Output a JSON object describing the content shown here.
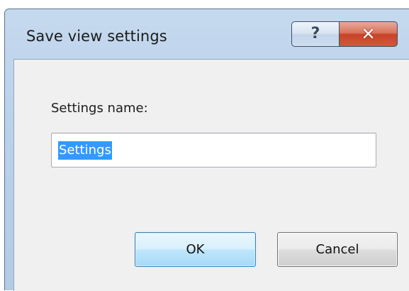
{
  "window": {
    "title": "Save view settings",
    "help_icon": "help-icon",
    "close_icon": "close-icon",
    "help_glyph": "?",
    "close_glyph": "✕"
  },
  "form": {
    "label": "Settings name:",
    "input_value": "Settings"
  },
  "buttons": {
    "ok_label": "OK",
    "cancel_label": "Cancel"
  },
  "colors": {
    "selection": "#3399ff",
    "close_button": "#c8432a",
    "frame": "#b9d1ea"
  }
}
